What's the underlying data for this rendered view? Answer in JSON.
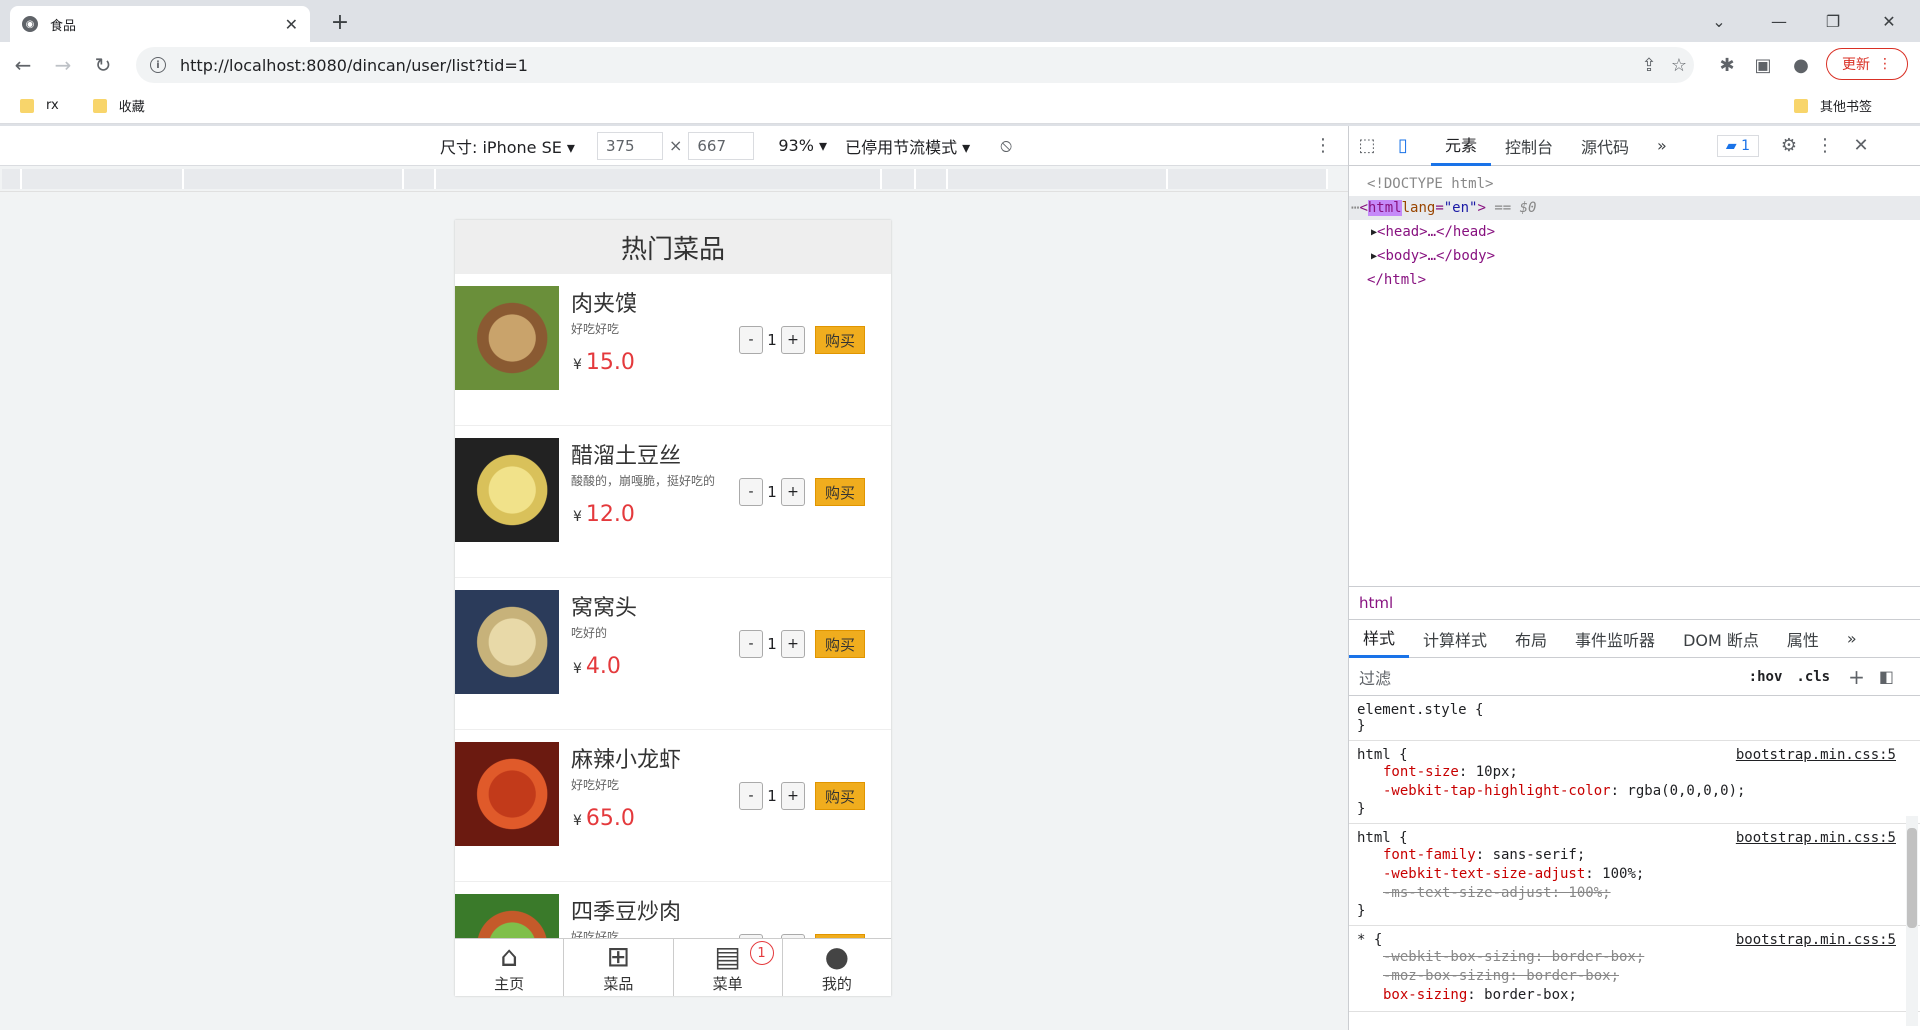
{
  "browser": {
    "tab_title": "食品",
    "url": "http://localhost:8080/dincan/user/list?tid=1",
    "update_label": "更新",
    "bookmarks": [
      "rx",
      "收藏"
    ],
    "other_bookmarks": "其他书签"
  },
  "device_toolbar": {
    "size_label": "尺寸: iPhone SE",
    "width": "375",
    "height": "667",
    "times": "×",
    "zoom": "93%",
    "throttle": "已停用节流模式"
  },
  "app": {
    "title": "热门菜品",
    "currency": "¥",
    "buy_label": "购买",
    "minus": "-",
    "plus": "+",
    "items": [
      {
        "name": "肉夹馍",
        "desc": "好吃好吃",
        "price": "15.0",
        "qty": "1"
      },
      {
        "name": "醋溜土豆丝",
        "desc": "酸酸的，崩嘎脆，挺好吃的",
        "price": "12.0",
        "qty": "1"
      },
      {
        "name": "窝窝头",
        "desc": "吃好的",
        "price": "4.0",
        "qty": "1"
      },
      {
        "name": "麻辣小龙虾",
        "desc": "好吃好吃",
        "price": "65.0",
        "qty": "1"
      },
      {
        "name": "四季豆炒肉",
        "desc": "好吃好吃",
        "price": "",
        "qty": "1"
      }
    ],
    "tabbar": [
      {
        "label": "主页",
        "icon": "home-icon"
      },
      {
        "label": "菜品",
        "icon": "grid-icon"
      },
      {
        "label": "菜单",
        "icon": "menu-list-icon",
        "badge": "1"
      },
      {
        "label": "我的",
        "icon": "user-icon"
      }
    ]
  },
  "devtools": {
    "tabs": [
      "元素",
      "控制台",
      "源代码"
    ],
    "issues_count": "1",
    "dom": {
      "doctype": "<!DOCTYPE html>",
      "html_open": "html",
      "lang_attr": "lang",
      "lang_val": "\"en\"",
      "eq0": " == $0",
      "head": "<head>…</head>",
      "body": "<body>…</body>",
      "html_close": "</html>"
    },
    "breadcrumb": "html",
    "sub_tabs": [
      "样式",
      "计算样式",
      "布局",
      "事件监听器",
      "DOM 断点",
      "属性"
    ],
    "filter_placeholder": "过滤",
    "hov": ":hov",
    "cls": ".cls",
    "rules": {
      "r0_sel": "element.style {",
      "close": "}",
      "src": "bootstrap.min.css:5",
      "r1_sel": "html {",
      "r1_d1_name": "font-size",
      "r1_d1_val": ": 10px;",
      "r1_d2_name": "-webkit-tap-highlight-color",
      "r1_d2_val": ": rgba(0,0,0,0);",
      "r2_sel": "html {",
      "r2_d1_name": "font-family",
      "r2_d1_val": ": sans-serif;",
      "r2_d2_name": "-webkit-text-size-adjust",
      "r2_d2_val": ": 100%;",
      "r2_d3": "-ms-text-size-adjust: 100%;",
      "r3_sel": "* {",
      "r3_d1": "-webkit-box-sizing: border-box;",
      "r3_d2": "-moz-box-sizing: border-box;",
      "r3_d3_name": "box-sizing",
      "r3_d3_val": ": border-box;"
    }
  },
  "colors": {
    "price": "#e4393c",
    "buy_button": "#f0ad1e",
    "devtools_accent": "#1a73e8"
  }
}
